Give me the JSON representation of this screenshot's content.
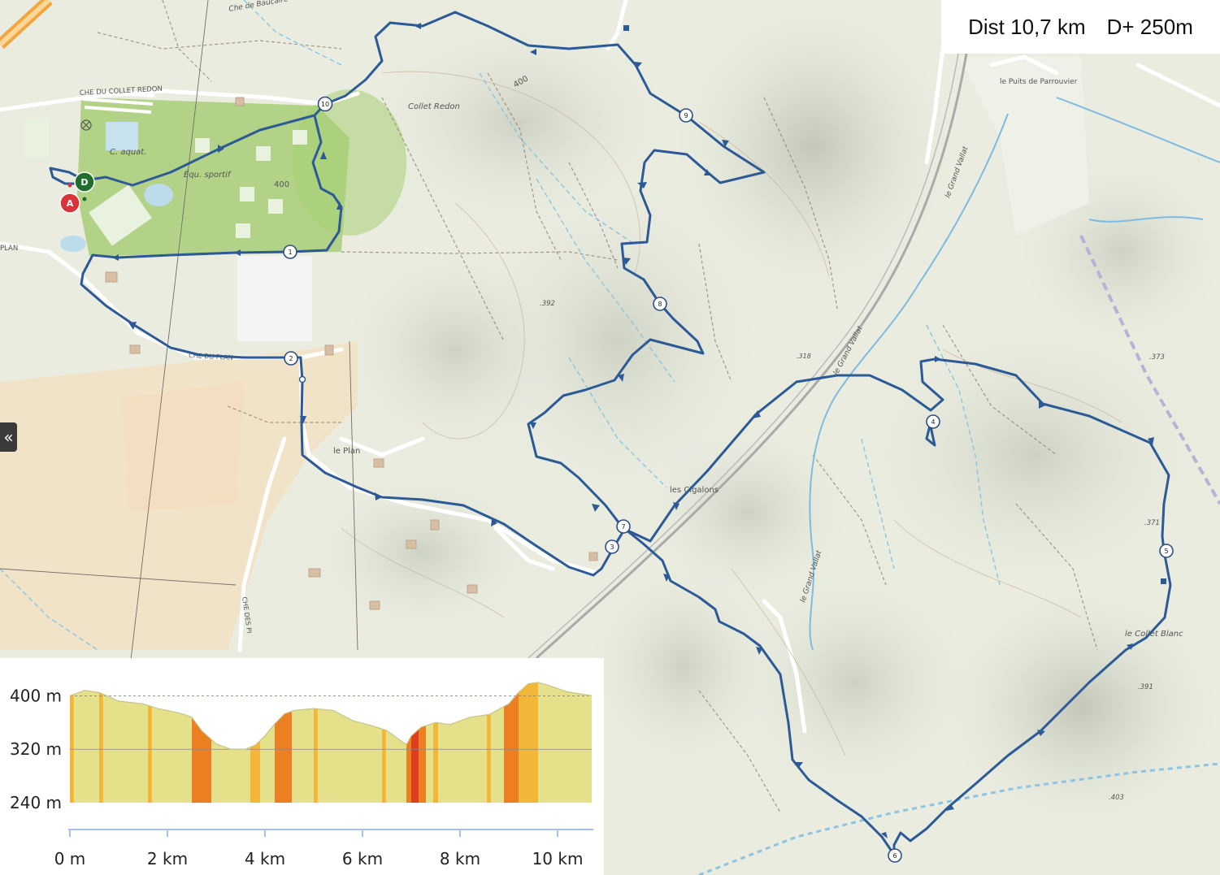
{
  "info": {
    "distance": "Dist 10,7 km",
    "elevation_gain": "D+ 250m"
  },
  "collapse_button": {
    "icon": "double-chevron-left-icon",
    "glyph": "«"
  },
  "map": {
    "labels": {
      "road_collet_redon": "CHE DU COLLET REDON",
      "aquatic": "C. aquat.",
      "sports": "Équ. sportif",
      "alt_400_park": "400",
      "alt_400_hill": "400",
      "collet_redon": "Collet Redon",
      "puits": "le Puits de Parrouvier",
      "grand_vallat_1": "le Grand Vallat",
      "grand_vallat_2": "le Grand Vallat",
      "grand_vallat_3": "le Grand Vallat",
      "alt_392": ".392",
      "alt_373": ".373",
      "alt_371": ".371",
      "alt_391": ".391",
      "alt_403": ".403",
      "alt_318": ".318",
      "le_plan": "le Plan",
      "les_cigalons": "les Cigalons",
      "collet_blanc": "le Collet Blanc",
      "che_plan": "CHE DU PLAN",
      "plan_left": "PLAN",
      "che_dessus": "CHE DES PI",
      "che_baucaire": "Che de Baucaire"
    },
    "markers": {
      "start": "D",
      "end": "A"
    },
    "waypoints": [
      "1",
      "2",
      "3",
      "4",
      "5",
      "6",
      "7",
      "8",
      "9",
      "10"
    ],
    "route_color": "#2b5a97",
    "park_color": "#9fca6a"
  },
  "chart_data": {
    "type": "area",
    "title": "",
    "xlabel": "",
    "ylabel": "",
    "xlim": [
      0,
      10.7
    ],
    "ylim": [
      240,
      420
    ],
    "x_ticks": [
      "0 m",
      "2 km",
      "4 km",
      "6 km",
      "8 km",
      "10 km"
    ],
    "x_tick_values": [
      0,
      2,
      4,
      6,
      8,
      10
    ],
    "y_ticks": [
      "400 m",
      "320 m",
      "240 m"
    ],
    "y_tick_values": [
      400,
      320,
      240
    ],
    "x": [
      0,
      0.3,
      0.6,
      1.0,
      1.5,
      1.8,
      2.0,
      2.3,
      2.5,
      2.7,
      3.0,
      3.3,
      3.6,
      3.8,
      4.0,
      4.2,
      4.4,
      4.6,
      5.0,
      5.4,
      5.8,
      6.2,
      6.5,
      6.8,
      6.9,
      7.0,
      7.2,
      7.5,
      7.8,
      8.2,
      8.6,
      9.0,
      9.2,
      9.4,
      9.6,
      9.8,
      10.2,
      10.7
    ],
    "y": [
      400,
      408,
      405,
      392,
      388,
      381,
      378,
      373,
      368,
      348,
      328,
      320,
      320,
      326,
      340,
      358,
      373,
      378,
      381,
      378,
      363,
      355,
      348,
      332,
      327,
      340,
      353,
      360,
      357,
      368,
      372,
      388,
      405,
      418,
      420,
      416,
      406,
      400
    ],
    "slope_bands": [
      {
        "from": 0.0,
        "to": 0.08,
        "grade": "moderate"
      },
      {
        "from": 0.6,
        "to": 0.68,
        "grade": "moderate"
      },
      {
        "from": 1.6,
        "to": 1.68,
        "grade": "moderate"
      },
      {
        "from": 2.5,
        "to": 2.9,
        "grade": "steep"
      },
      {
        "from": 3.7,
        "to": 3.9,
        "grade": "moderate"
      },
      {
        "from": 4.2,
        "to": 4.55,
        "grade": "steep"
      },
      {
        "from": 5.0,
        "to": 5.08,
        "grade": "moderate"
      },
      {
        "from": 6.4,
        "to": 6.48,
        "grade": "moderate"
      },
      {
        "from": 6.9,
        "to": 7.0,
        "grade": "steep"
      },
      {
        "from": 7.0,
        "to": 7.15,
        "grade": "very-steep"
      },
      {
        "from": 7.15,
        "to": 7.3,
        "grade": "steep"
      },
      {
        "from": 7.45,
        "to": 7.55,
        "grade": "moderate"
      },
      {
        "from": 8.55,
        "to": 8.63,
        "grade": "moderate"
      },
      {
        "from": 8.9,
        "to": 9.2,
        "grade": "steep"
      },
      {
        "from": 9.2,
        "to": 9.6,
        "grade": "moderate"
      }
    ],
    "colors": {
      "base": "#e4e18a",
      "moderate": "#f2b739",
      "steep": "#ec7f22",
      "very-steep": "#dd3e1c",
      "outline": "#c7c48a",
      "axis": "#a8c0e6"
    }
  }
}
